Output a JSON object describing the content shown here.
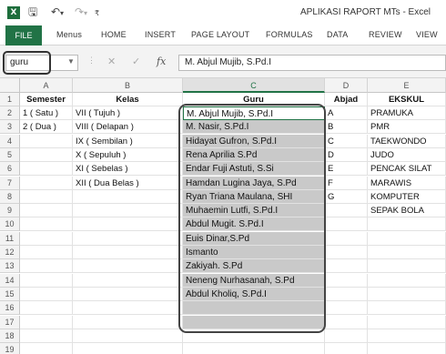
{
  "window": {
    "title": "APLIKASI RAPORT MTs - Excel"
  },
  "quick_access": {
    "logo_text": "X",
    "save_icon": "save-icon",
    "undo_icon": "undo-icon",
    "redo_icon": "redo-icon",
    "customize_icon": "customize-icon"
  },
  "ribbon": {
    "file": "FILE",
    "tabs": [
      "Menus",
      "HOME",
      "INSERT",
      "PAGE LAYOUT",
      "FORMULAS",
      "DATA",
      "REVIEW",
      "VIEW"
    ]
  },
  "formula_bar": {
    "name_box": "guru",
    "cancel_glyph": "✕",
    "enter_glyph": "✓",
    "fx_label": "fx",
    "value": "M. Abjul Mujib, S.Pd.I"
  },
  "sheet": {
    "columns": [
      "A",
      "B",
      "C",
      "D",
      "E"
    ],
    "selected_column": "C",
    "headers": [
      "Semester",
      "Kelas",
      "Guru",
      "Abjad",
      "EKSKUL"
    ],
    "rows": [
      {
        "n": "2",
        "a": "1 ( Satu )",
        "b": "VII ( Tujuh )",
        "c": "M. Abjul Mujib, S.Pd.I",
        "d": "A",
        "e": "PRAMUKA"
      },
      {
        "n": "3",
        "a": "2 ( Dua )",
        "b": "VIII ( Delapan )",
        "c": "M. Nasir, S.Pd.I",
        "d": "B",
        "e": "PMR"
      },
      {
        "n": "4",
        "a": "",
        "b": "IX ( Sembilan )",
        "c": "Hidayat Gufron, S.Pd.I",
        "d": "C",
        "e": "TAEKWONDO"
      },
      {
        "n": "5",
        "a": "",
        "b": "X ( Sepuluh )",
        "c": "Rena Aprilia S.Pd",
        "d": "D",
        "e": "JUDO"
      },
      {
        "n": "6",
        "a": "",
        "b": "XI ( Sebelas )",
        "c": "Endar Fuji Astuti, S.Si",
        "d": "E",
        "e": "PENCAK SILAT"
      },
      {
        "n": "7",
        "a": "",
        "b": "XII ( Dua Belas )",
        "c": "Hamdan Lugina Jaya, S.Pd",
        "d": "F",
        "e": "MARAWIS"
      },
      {
        "n": "8",
        "a": "",
        "b": "",
        "c": "Ryan Triana Maulana, SHI",
        "d": "G",
        "e": "KOMPUTER"
      },
      {
        "n": "9",
        "a": "",
        "b": "",
        "c": "Muhaemin Lutfi, S.Pd.I",
        "d": "",
        "e": "SEPAK BOLA"
      },
      {
        "n": "10",
        "a": "",
        "b": "",
        "c": "Abdul Mugit. S.Pd.I",
        "d": "",
        "e": ""
      },
      {
        "n": "11",
        "a": "",
        "b": "",
        "c": "Euis Dinar,S.Pd",
        "d": "",
        "e": ""
      },
      {
        "n": "12",
        "a": "",
        "b": "",
        "c": "Ismanto",
        "d": "",
        "e": ""
      },
      {
        "n": "13",
        "a": "",
        "b": "",
        "c": "Zakiyah. S.Pd",
        "d": "",
        "e": ""
      },
      {
        "n": "14",
        "a": "",
        "b": "",
        "c": "Neneng Nurhasanah, S.Pd",
        "d": "",
        "e": ""
      },
      {
        "n": "15",
        "a": "",
        "b": "",
        "c": "Abdul Kholiq, S.Pd.I",
        "d": "",
        "e": ""
      },
      {
        "n": "16",
        "a": "",
        "b": "",
        "c": "",
        "d": "",
        "e": ""
      },
      {
        "n": "17",
        "a": "",
        "b": "",
        "c": "",
        "d": "",
        "e": ""
      },
      {
        "n": "18",
        "a": "",
        "b": "",
        "c": "",
        "d": "",
        "e": ""
      },
      {
        "n": "19",
        "a": "",
        "b": "",
        "c": "",
        "d": "",
        "e": ""
      }
    ],
    "header_row_number": "1"
  },
  "colors": {
    "excel_green": "#217346",
    "selection_gray": "#c9c9c9",
    "highlight_outline": "#444444"
  }
}
